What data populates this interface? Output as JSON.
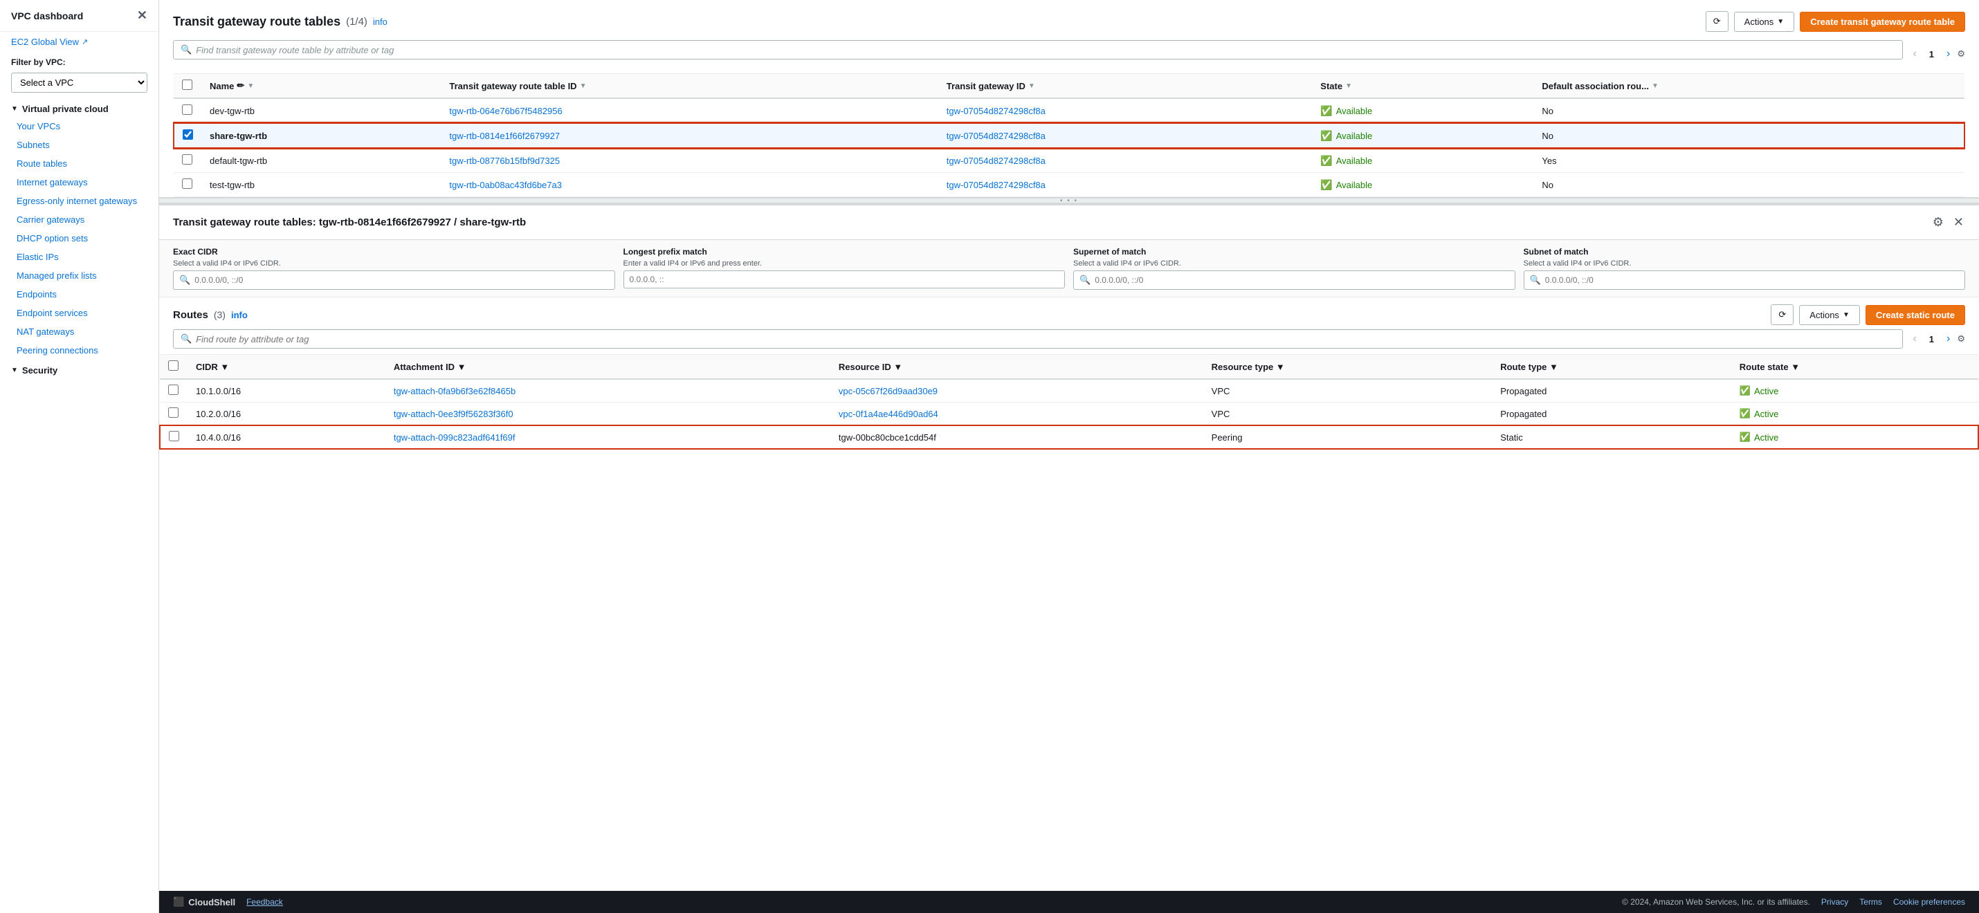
{
  "sidebar": {
    "title": "VPC dashboard",
    "ec2_global_view": "EC2 Global View",
    "filter_label": "Filter by VPC:",
    "filter_placeholder": "Select a VPC",
    "virtual_private_cloud": "Virtual private cloud",
    "items": [
      {
        "label": "Your VPCs",
        "id": "your-vpcs"
      },
      {
        "label": "Subnets",
        "id": "subnets"
      },
      {
        "label": "Route tables",
        "id": "route-tables"
      },
      {
        "label": "Internet gateways",
        "id": "internet-gateways"
      },
      {
        "label": "Egress-only internet gateways",
        "id": "egress-gateways"
      },
      {
        "label": "Carrier gateways",
        "id": "carrier-gateways"
      },
      {
        "label": "DHCP option sets",
        "id": "dhcp-option-sets"
      },
      {
        "label": "Elastic IPs",
        "id": "elastic-ips"
      },
      {
        "label": "Managed prefix lists",
        "id": "managed-prefix-lists"
      },
      {
        "label": "Endpoints",
        "id": "endpoints"
      },
      {
        "label": "Endpoint services",
        "id": "endpoint-services"
      },
      {
        "label": "NAT gateways",
        "id": "nat-gateways"
      },
      {
        "label": "Peering connections",
        "id": "peering-connections"
      }
    ],
    "security_section": "Security"
  },
  "top_panel": {
    "title": "Transit gateway route tables",
    "count": "(1/4)",
    "info_link": "info",
    "refresh_label": "⟳",
    "actions_label": "Actions",
    "create_button_label": "Create transit gateway route table",
    "search_placeholder": "Find transit gateway route table by attribute or tag",
    "page_num": "1",
    "columns": [
      {
        "label": "Name",
        "editable": true
      },
      {
        "label": "Transit gateway route table ID"
      },
      {
        "label": "Transit gateway ID"
      },
      {
        "label": "State"
      },
      {
        "label": "Default association rou..."
      }
    ],
    "rows": [
      {
        "id": "row-1",
        "name": "dev-tgw-rtb",
        "rtb_id": "tgw-rtb-064e76b67f5482956",
        "tgw_id": "tgw-07054d8274298cf8a",
        "state": "Available",
        "default_association": "No",
        "selected": false,
        "checked": false
      },
      {
        "id": "row-2",
        "name": "share-tgw-rtb",
        "rtb_id": "tgw-rtb-0814e1f66f2679927",
        "tgw_id": "tgw-07054d8274298cf8a",
        "state": "Available",
        "default_association": "No",
        "selected": true,
        "checked": true
      },
      {
        "id": "row-3",
        "name": "default-tgw-rtb",
        "rtb_id": "tgw-rtb-08776b15fbf9d7325",
        "tgw_id": "tgw-07054d8274298cf8a",
        "state": "Available",
        "default_association": "Yes",
        "selected": false,
        "checked": false
      },
      {
        "id": "row-4",
        "name": "test-tgw-rtb",
        "rtb_id": "tgw-rtb-0ab08ac43fd6be7a3",
        "tgw_id": "tgw-07054d8274298cf8a",
        "state": "Available",
        "default_association": "No",
        "selected": false,
        "checked": false
      }
    ]
  },
  "detail_panel": {
    "title": "Transit gateway route tables: tgw-rtb-0814e1f66f2679927 / share-tgw-rtb",
    "filters": {
      "exact_cidr": {
        "label": "Exact CIDR",
        "sublabel": "Select a valid IP4 or IPv6 CIDR.",
        "placeholder": "0.0.0.0/0, ::/0"
      },
      "longest_prefix": {
        "label": "Longest prefix match",
        "sublabel": "Enter a valid IP4 or IPv6 and press enter.",
        "placeholder": "0.0.0.0, ::"
      },
      "supernet_of_match": {
        "label": "Supernet of match",
        "sublabel": "Select a valid IP4 or IPv6 CIDR.",
        "placeholder": "0.0.0.0/0, ::/0"
      },
      "subnet_of_match": {
        "label": "Subnet of match",
        "sublabel": "Select a valid IP4 or IPv6 CIDR.",
        "placeholder": "0.0.0.0/0, ::/0"
      }
    },
    "routes": {
      "title": "Routes",
      "count": "(3)",
      "info_link": "info",
      "actions_label": "Actions",
      "create_static_label": "Create static route",
      "search_placeholder": "Find route by attribute or tag",
      "page_num": "1",
      "columns": [
        {
          "label": "CIDR"
        },
        {
          "label": "Attachment ID"
        },
        {
          "label": "Resource ID"
        },
        {
          "label": "Resource type"
        },
        {
          "label": "Route type"
        },
        {
          "label": "Route state"
        }
      ],
      "rows": [
        {
          "id": "route-1",
          "cidr": "10.1.0.0/16",
          "attachment_id": "tgw-attach-0fa9b6f3e62f8465b",
          "resource_id": "vpc-05c67f26d9aad30e9",
          "resource_type": "VPC",
          "route_type": "Propagated",
          "route_state": "Active",
          "highlighted": false
        },
        {
          "id": "route-2",
          "cidr": "10.2.0.0/16",
          "attachment_id": "tgw-attach-0ee3f9f56283f36f0",
          "resource_id": "vpc-0f1a4ae446d90ad64",
          "resource_type": "VPC",
          "route_type": "Propagated",
          "route_state": "Active",
          "highlighted": false
        },
        {
          "id": "route-3",
          "cidr": "10.4.0.0/16",
          "attachment_id": "tgw-attach-099c823adf641f69f",
          "resource_id": "tgw-00bc80cbce1cdd54f",
          "resource_type": "Peering",
          "route_type": "Static",
          "route_state": "Active",
          "highlighted": true
        }
      ]
    }
  },
  "footer": {
    "brand": "CloudShell",
    "feedback": "Feedback",
    "copyright": "© 2024, Amazon Web Services, Inc. or its affiliates.",
    "privacy": "Privacy",
    "terms": "Terms",
    "cookie_preferences": "Cookie preferences"
  }
}
